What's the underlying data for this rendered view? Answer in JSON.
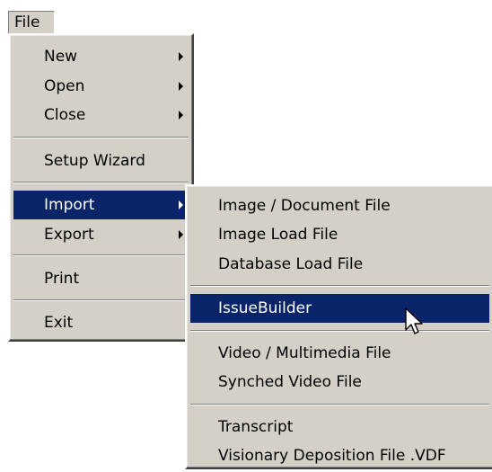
{
  "menubar": {
    "file_label": "File"
  },
  "file_menu": {
    "new": "New",
    "open": "Open",
    "close": "Close",
    "setup_wizard": "Setup Wizard",
    "import": "Import",
    "export": "Export",
    "print": "Print",
    "exit": "Exit"
  },
  "import_menu": {
    "image_document_file": "Image / Document File",
    "image_load_file": "Image Load File",
    "database_load_file": "Database Load File",
    "issuebuilder": "IssueBuilder",
    "video_multimedia_file": "Video / Multimedia File",
    "synched_video_file": "Synched Video File",
    "transcript": "Transcript",
    "visionary_deposition_file": "Visionary Deposition File .VDF"
  },
  "colors": {
    "menu_face": "#d4d0c8",
    "highlight": "#0a246a",
    "highlight_text": "#ffffff"
  },
  "icons": {
    "cursor": "arrow-pointer-icon",
    "submenu": "submenu-arrow-icon"
  }
}
